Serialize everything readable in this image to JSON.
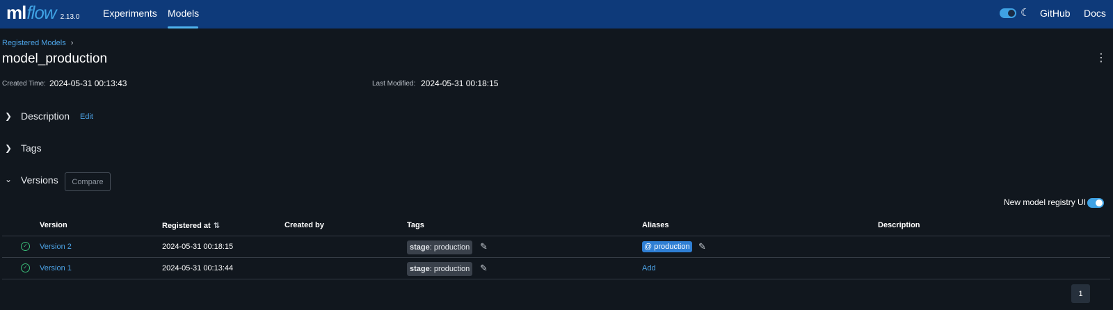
{
  "header": {
    "logo_ml": "ml",
    "logo_flow": "flow",
    "version": "2.13.0",
    "nav": [
      "Experiments",
      "Models"
    ],
    "active_nav": "Models",
    "github": "GitHub",
    "docs": "Docs",
    "theme_toggle_icon": "moon-icon",
    "accent": "#0e3a7a"
  },
  "breadcrumb": {
    "label": "Registered Models",
    "separator": "›"
  },
  "title": "model_production",
  "meta": {
    "created_label": "Created Time:",
    "created_value": "2024-05-31 00:13:43",
    "modified_label": "Last Modified:",
    "modified_value": "2024-05-31 00:18:15"
  },
  "sections": {
    "description": "Description",
    "edit": "Edit",
    "tags": "Tags",
    "versions": "Versions",
    "compare": "Compare"
  },
  "new_ui_label": "New model registry UI",
  "table": {
    "columns": [
      "Version",
      "Registered at",
      "Created by",
      "Tags",
      "Aliases",
      "Description"
    ],
    "rows": [
      {
        "version": "Version 2",
        "registered_at": "2024-05-31 00:18:15",
        "created_by": "",
        "tag_key": "stage",
        "tag_value": ": production",
        "alias": "@ production",
        "description": ""
      },
      {
        "version": "Version 1",
        "registered_at": "2024-05-31 00:13:44",
        "created_by": "",
        "tag_key": "stage",
        "tag_value": ": production",
        "alias_action": "Add",
        "description": ""
      }
    ]
  },
  "pagination": {
    "current_page": "1"
  }
}
